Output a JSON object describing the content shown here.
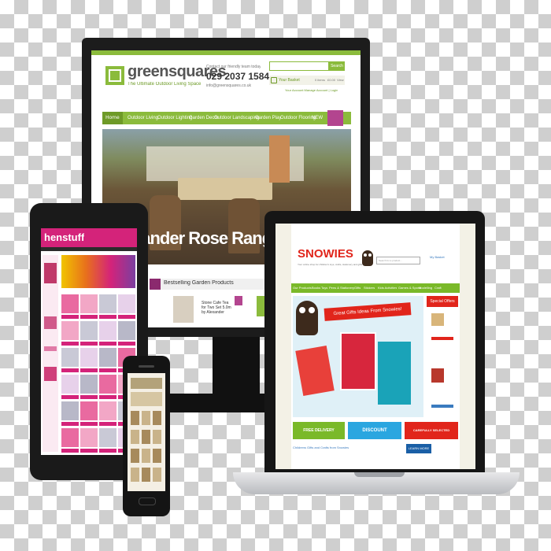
{
  "monitor": {
    "brand_name": "greensquares",
    "tagline": "The Ultimate Outdoor Living Space",
    "contact_label": "Contact our friendly team today",
    "phone": "029 2037 1584",
    "email": "info@greensquares.co.uk",
    "search_button": "Search",
    "basket_label": "Your Basket",
    "basket_items": "0 items",
    "basket_total": "£0.00",
    "basket_view": "View",
    "account_links": "Your Account  Manage Account | Login",
    "nav": [
      "Home",
      "Outdoor Living",
      "Outdoor Lighting",
      "Garden Decor",
      "Outdoor Landscaping",
      "Garden Play",
      "Outdoor Flooring",
      "NEW"
    ],
    "hero_caption": "xander Rose Range 2013",
    "section_title": "Bestselling Garden Products",
    "product_text": "Stone Cafe Tea for Two Set 5.0m by Alexander"
  },
  "tablet": {
    "brand_name": "henstuff"
  },
  "laptop": {
    "brand_name": "SNOWIES",
    "tagline": "Your online shop for children's toys, crafts, stationery and gifts",
    "search_placeholder": "Search for a product...",
    "my_basket": "My Basket",
    "nav": [
      "Our Products",
      "Books",
      "Toys",
      "Pens & Stationery",
      "Gifts",
      "Stickers",
      "Kids Activities",
      "Games & Sports",
      "Modelling",
      "Craft"
    ],
    "hero_title": "Great Gifts Ideas From Snowies!",
    "special_offers": "Special Offers",
    "badges": [
      "FREE DELIVERY",
      "DISCOUNT",
      "CAREFULLY SELECTED"
    ],
    "footer_link": "Childrens Gifts and Crafts from Snowies",
    "learn_more": "LEARN MORE"
  }
}
